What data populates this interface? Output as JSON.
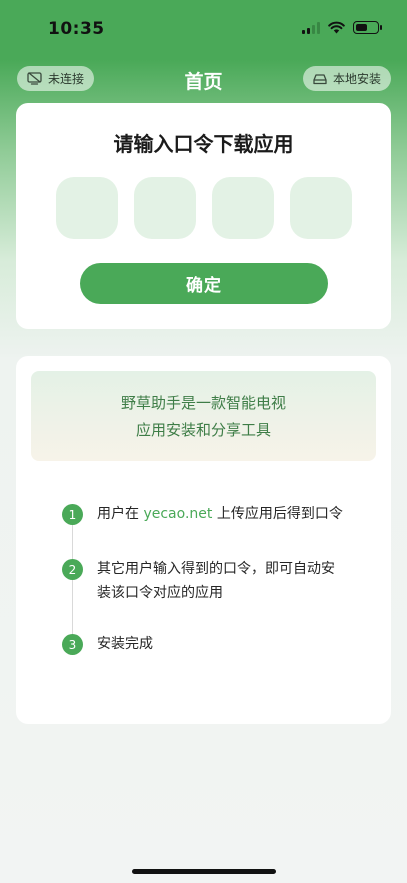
{
  "status_bar": {
    "time": "10:35"
  },
  "nav": {
    "title": "首页",
    "left_label": "未连接",
    "right_label": "本地安装"
  },
  "code_card": {
    "title": "请输入口令下载应用",
    "confirm_label": "确定"
  },
  "intro": {
    "line1": "野草助手是一款智能电视",
    "line2": "应用安装和分享工具"
  },
  "steps": [
    {
      "num": "1",
      "before": "用户在 ",
      "link": "yecao.net",
      "after": " 上传应用后得到口令"
    },
    {
      "num": "2",
      "line1": "其它用户输入得到的口令，即可自动安",
      "line2": "装该口令对应的应用"
    },
    {
      "num": "3",
      "text": "安装完成"
    }
  ],
  "colors": {
    "brand": "#4aa958",
    "box": "#e3f2e5"
  },
  "battery_level": 0.6
}
